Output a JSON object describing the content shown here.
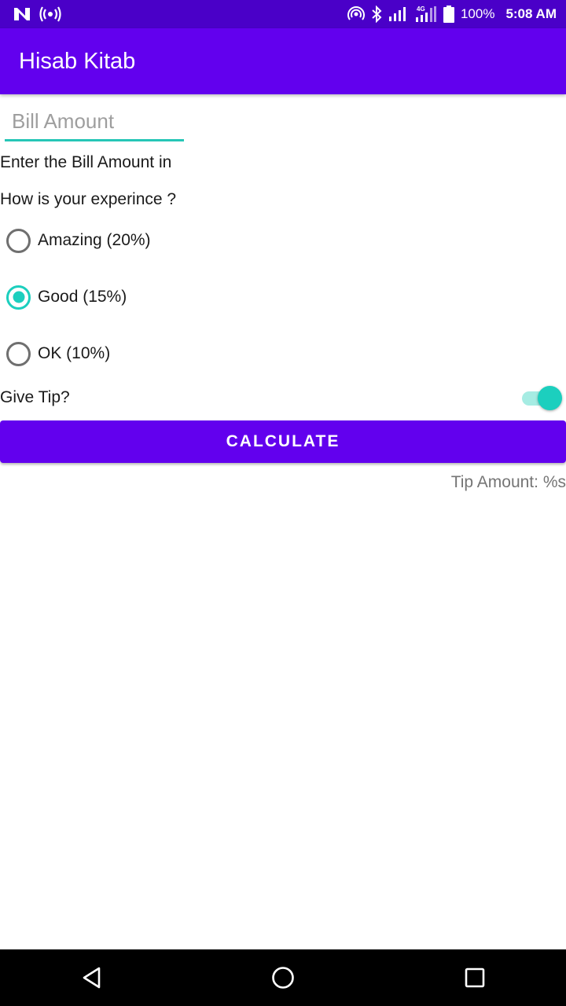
{
  "status_bar": {
    "left_icons": [
      "n-logo-icon",
      "broadcast-icon"
    ],
    "right_icons": [
      "hotspot-icon",
      "bluetooth-icon",
      "signal-icon",
      "signal-4g-icon",
      "battery-icon"
    ],
    "battery": "100%",
    "time": "5:08 AM"
  },
  "app_bar": {
    "title": "Hisab Kitab"
  },
  "form": {
    "bill_placeholder": "Bill Amount",
    "bill_value": "",
    "bill_hint": "Enter the Bill Amount in",
    "experience_question": "How is your experince ?",
    "options": [
      {
        "label": "Amazing (20%)",
        "selected": false
      },
      {
        "label": "Good (15%)",
        "selected": true
      },
      {
        "label": "OK (10%)",
        "selected": false
      }
    ],
    "give_tip_label": "Give Tip?",
    "give_tip_enabled": true,
    "calculate_label": "CALCULATE",
    "tip_amount_text": "Tip Amount: %s"
  },
  "nav_bar": {
    "buttons": [
      "back-icon",
      "home-icon",
      "recents-icon"
    ]
  },
  "colors": {
    "status_bar": "#4a00c8",
    "primary": "#6200ee",
    "accent": "#1ccfbe"
  }
}
